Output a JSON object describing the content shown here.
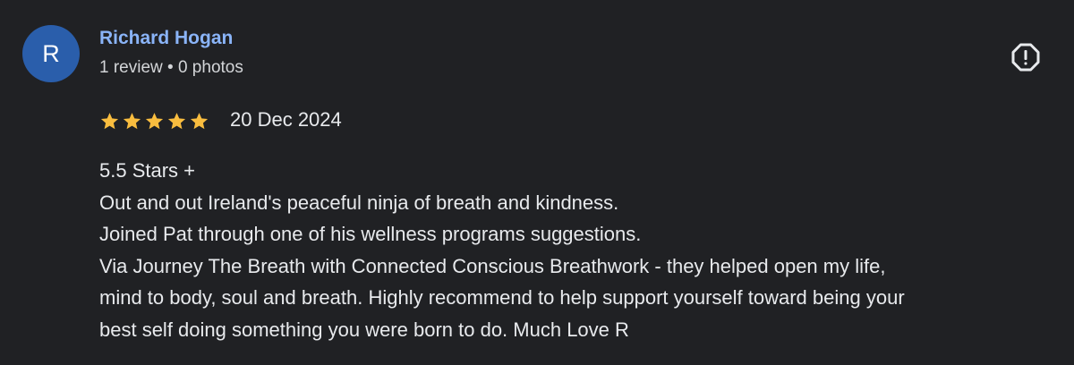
{
  "reviewer": {
    "initial": "R",
    "name": "Richard Hogan",
    "meta": "1 review • 0 photos"
  },
  "icons": {
    "report": "report-flag-icon",
    "star": "star-icon"
  },
  "colors": {
    "background": "#202124",
    "avatar": "#2a5eab",
    "name": "#8ab4f8",
    "star": "#f9bd3f",
    "text": "#e8eaed"
  },
  "review": {
    "rating": 5,
    "rating_max": 5,
    "date": "20 Dec 2024",
    "lines": [
      "5.5 Stars +",
      "Out and out Ireland's peaceful ninja of breath and kindness.",
      "Joined Pat through one of his wellness programs suggestions.",
      "Via Journey The Breath with Connected Conscious Breathwork - they helped open my life,",
      "mind to body, soul and breath. Highly recommend to help support yourself toward being your",
      "best self doing something you were born to do. Much Love R"
    ]
  }
}
